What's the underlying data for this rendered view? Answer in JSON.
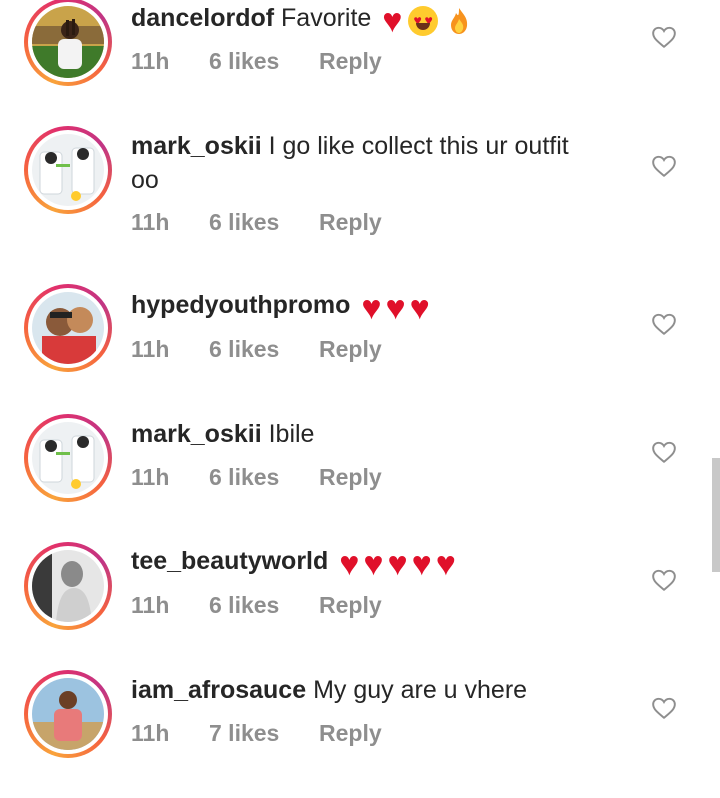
{
  "comments": [
    {
      "username": "dancelordof",
      "text": "Favorite",
      "time": "11h",
      "likes": "6 likes",
      "reply": "Reply",
      "emoji": "heart, heart-eyes, fire"
    },
    {
      "username": "mark_oskii",
      "text": "I go like collect this ur outfit",
      "text2": "oo",
      "time": "11h",
      "likes": "6 likes",
      "reply": "Reply"
    },
    {
      "username": "hypedyouthpromo",
      "text": "",
      "time": "11h",
      "likes": "6 likes",
      "reply": "Reply",
      "emoji": "3 red hearts"
    },
    {
      "username": "mark_oskii",
      "text": "Ibile",
      "time": "11h",
      "likes": "6 likes",
      "reply": "Reply"
    },
    {
      "username": "tee_beautyworld",
      "text": "",
      "time": "11h",
      "likes": "6 likes",
      "reply": "Reply",
      "emoji": "5 red hearts"
    },
    {
      "username": "iam_afrosauce",
      "text": "My guy are u vhere",
      "time": "11h",
      "likes": "7 likes",
      "reply": "Reply"
    }
  ],
  "icons": {
    "like": "heart-outline-icon",
    "heart": "red-heart-emoji",
    "heart_eyes": "heart-eyes-emoji",
    "fire": "fire-emoji"
  },
  "colors": {
    "text": "#262626",
    "meta": "#8e8e8e",
    "heart": "#e0102a",
    "ring_start": "#f9a33b",
    "ring_end": "#c13584"
  }
}
